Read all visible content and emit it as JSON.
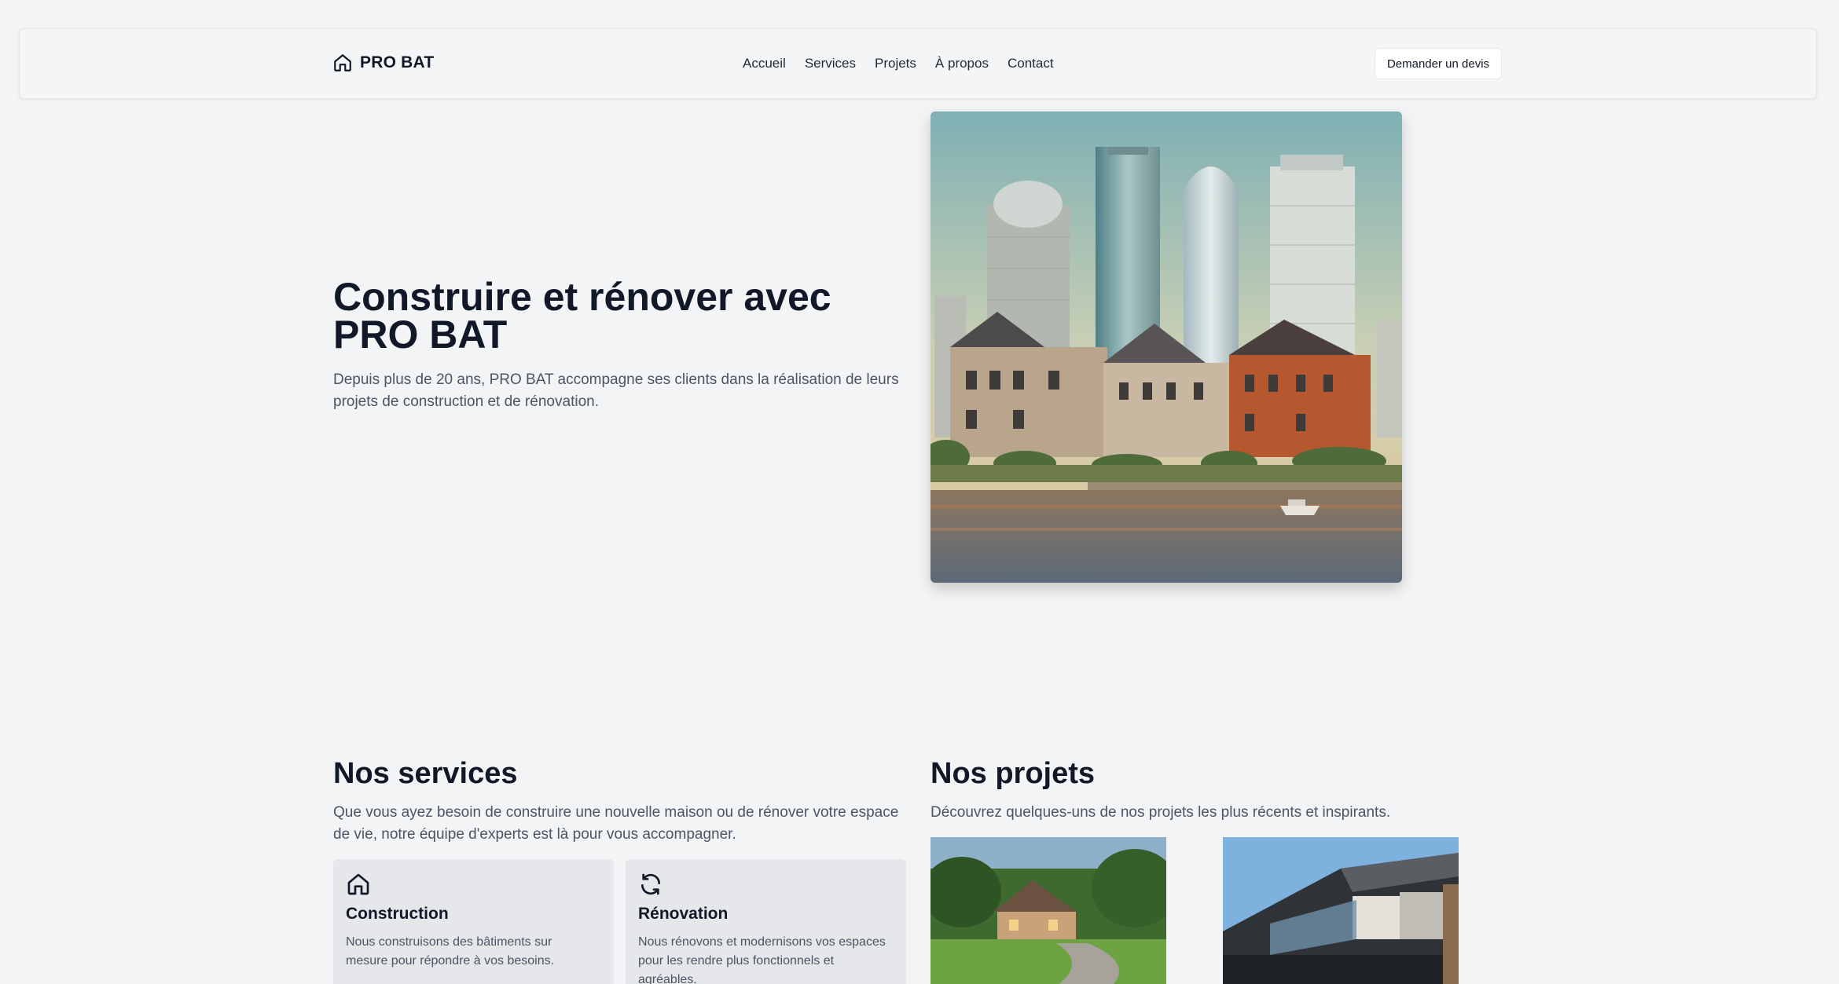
{
  "header": {
    "brand": "PRO BAT",
    "nav": [
      "Accueil",
      "Services",
      "Projets",
      "À propos",
      "Contact"
    ],
    "cta": "Demander un devis"
  },
  "hero": {
    "title_line1": "Construire et rénover avec",
    "title_line2": "PRO BAT",
    "subtitle": "Depuis plus de 20 ans, PRO BAT accompagne ses clients dans la réalisation de leurs projets de construction et de rénovation."
  },
  "services": {
    "title": "Nos services",
    "description": "Que vous ayez besoin de construire une nouvelle maison ou de rénover votre espace de vie, notre équipe d'experts est là pour vous accompagner.",
    "cards": [
      {
        "icon": "home-icon",
        "title": "Construction",
        "description": "Nous construisons des bâtiments sur mesure pour répondre à vos besoins."
      },
      {
        "icon": "refresh-icon",
        "title": "Rénovation",
        "description": "Nous rénovons et modernisons vos espaces pour les rendre plus fonctionnels et agréables."
      }
    ]
  },
  "projects": {
    "title": "Nos projets",
    "description": "Découvrez quelques-uns de nos projets les plus récents et inspirants."
  },
  "colors": {
    "background": "#f3f4f6",
    "text": "#111827",
    "muted": "#4b5563",
    "card": "#e5e7eb"
  }
}
